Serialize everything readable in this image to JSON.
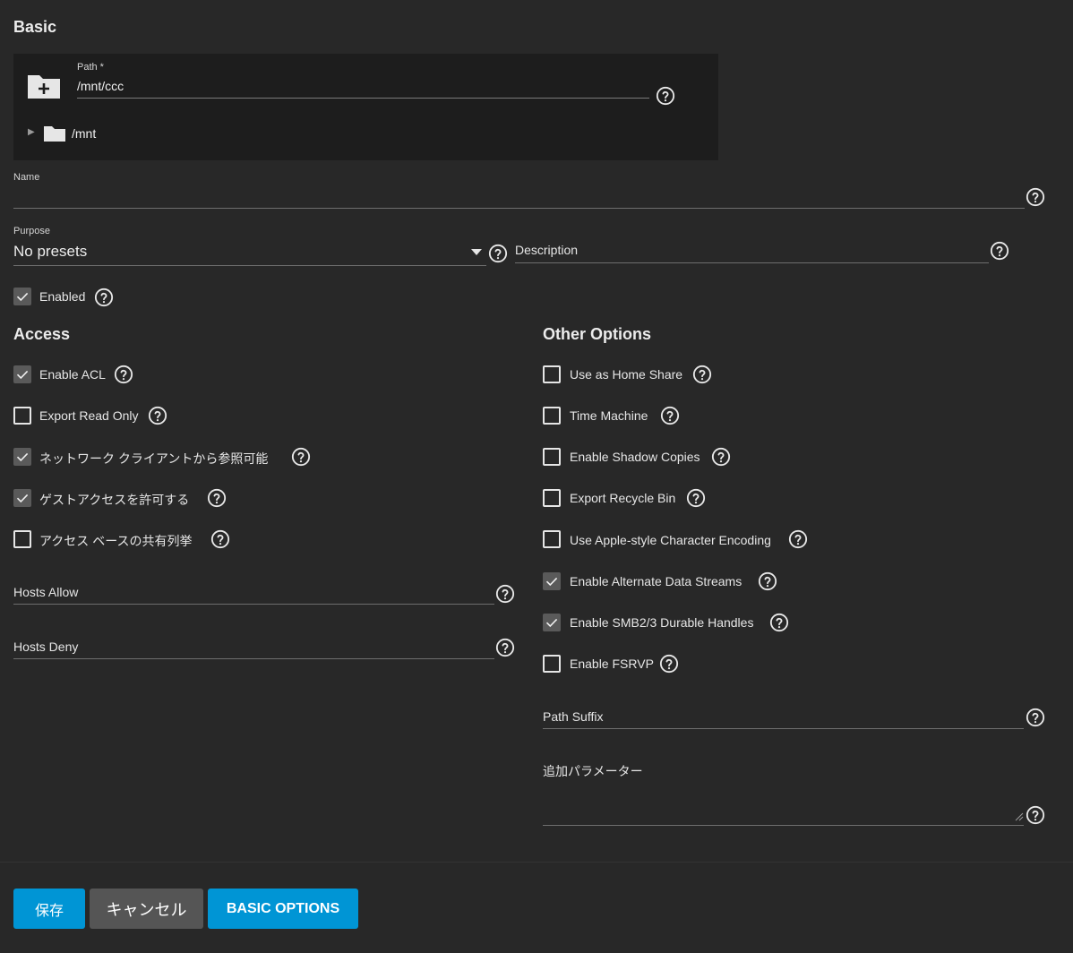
{
  "basic": {
    "title": "Basic",
    "path_label": "Path *",
    "path_value": "/mnt/ccc",
    "tree_root": "/mnt",
    "name_label": "Name",
    "purpose_label": "Purpose",
    "purpose_value": "No presets",
    "description_label": "Description",
    "enabled_label": "Enabled"
  },
  "access": {
    "title": "Access",
    "items": [
      {
        "label": "Enable ACL",
        "checked": true
      },
      {
        "label": "Export Read Only",
        "checked": false
      },
      {
        "label": "ネットワーク クライアントから参照可能",
        "checked": true
      },
      {
        "label": "ゲストアクセスを許可する",
        "checked": true
      },
      {
        "label": "アクセス ベースの共有列挙",
        "checked": false
      }
    ],
    "hosts_allow_label": "Hosts Allow",
    "hosts_deny_label": "Hosts Deny"
  },
  "other": {
    "title": "Other Options",
    "items": [
      {
        "label": "Use as Home Share",
        "checked": false
      },
      {
        "label": "Time Machine",
        "checked": false
      },
      {
        "label": "Enable Shadow Copies",
        "checked": false
      },
      {
        "label": "Export Recycle Bin",
        "checked": false
      },
      {
        "label": "Use Apple-style Character Encoding",
        "checked": false
      },
      {
        "label": "Enable Alternate Data Streams",
        "checked": true
      },
      {
        "label": "Enable SMB2/3 Durable Handles",
        "checked": true
      },
      {
        "label": "Enable FSRVP",
        "checked": false
      }
    ],
    "path_suffix_label": "Path Suffix",
    "aux_params_label": "追加パラメーター"
  },
  "buttons": {
    "save": "保存",
    "cancel": "キャンセル",
    "basic_options": "BASIC OPTIONS"
  },
  "colors": {
    "background": "#282828",
    "panel": "#1d1d1d",
    "primary": "#0095d5",
    "secondary_button": "#555555"
  }
}
